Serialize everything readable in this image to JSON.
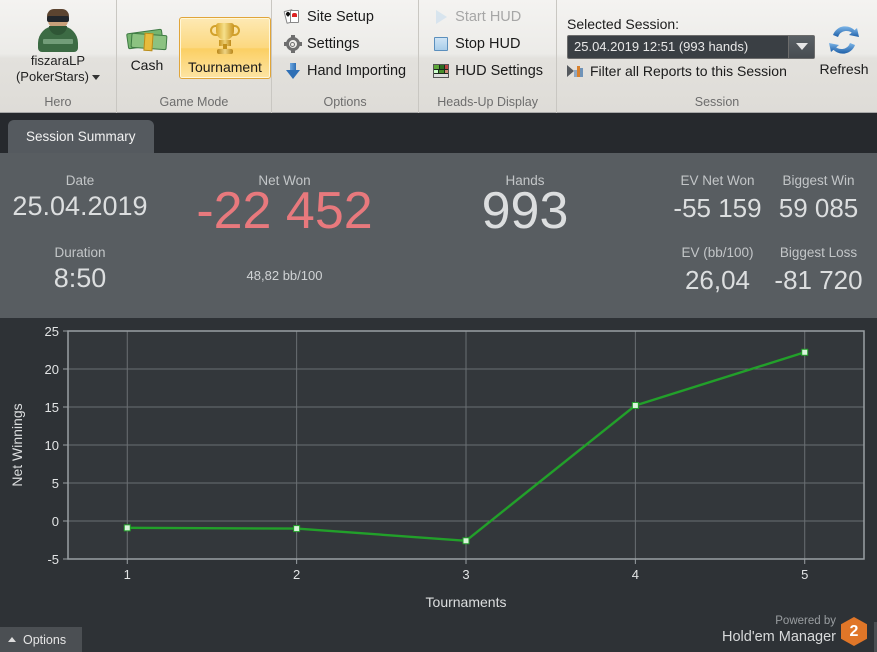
{
  "ribbon": {
    "hero": {
      "group_title": "Hero",
      "name": "fiszaraLP",
      "site": "(PokerStars)",
      "avatar_icon": "player-avatar"
    },
    "game_mode": {
      "group_title": "Game Mode",
      "cash_label": "Cash",
      "tournament_label": "Tournament",
      "selected": "Tournament"
    },
    "options": {
      "group_title": "Options",
      "items": [
        {
          "label": "Site Setup",
          "icon": "cards-icon",
          "disabled": false
        },
        {
          "label": "Settings",
          "icon": "gear-icon",
          "disabled": false
        },
        {
          "label": "Hand Importing",
          "icon": "download-arrow-icon",
          "disabled": false
        }
      ]
    },
    "hud": {
      "group_title": "Heads-Up Display",
      "items": [
        {
          "label": "Start HUD",
          "icon": "play-icon",
          "disabled": true
        },
        {
          "label": "Stop HUD",
          "icon": "stop-square-icon",
          "disabled": false
        },
        {
          "label": "HUD Settings",
          "icon": "hud-grid-icon",
          "disabled": false
        }
      ]
    },
    "session": {
      "group_title": "Session",
      "label": "Selected Session:",
      "selected_value": "25.04.2019 12:51 (993 hands)",
      "filter_label": "Filter all Reports to this Session",
      "filter_icon": "filter-chart-icon",
      "refresh_label": "Refresh",
      "refresh_icon": "refresh-icon"
    }
  },
  "tabs": [
    {
      "label": "Session Summary",
      "active": true
    }
  ],
  "stats": [
    {
      "label": "Date",
      "value": "25.04.2019",
      "key": "date"
    },
    {
      "label": "Duration",
      "value": "8:50",
      "key": "duration"
    },
    {
      "label": "Net Won",
      "value": "-22 452",
      "key": "net_won",
      "sub": "48,82 bb/100"
    },
    {
      "label": "Hands",
      "value": "993",
      "key": "hands"
    },
    {
      "label": "EV Net Won",
      "value": "-55 159",
      "key": "ev_net_won"
    },
    {
      "label": "EV (bb/100)",
      "value": "26,04",
      "key": "ev_bb100"
    },
    {
      "label": "Biggest Win",
      "value": "59 085",
      "key": "biggest_win"
    },
    {
      "label": "Biggest Loss",
      "value": "-81 720",
      "key": "biggest_loss"
    }
  ],
  "colors": {
    "negative": "#e8797d",
    "value": "#dcdedf",
    "line": "#22a02a",
    "accent_orange": "#e07628",
    "selected_tab": "#555a5f"
  },
  "chart_data": {
    "type": "line",
    "title": "",
    "xlabel": "Tournaments",
    "ylabel": "Net Winnings",
    "x": [
      1,
      2,
      3,
      4,
      5
    ],
    "categories": [
      "1",
      "2",
      "3",
      "4",
      "5"
    ],
    "series": [
      {
        "name": "Net Winnings",
        "values": [
          -0.9,
          -1.0,
          -2.6,
          15.2,
          22.2
        ],
        "color": "#22a02a"
      }
    ],
    "xlim": [
      0.65,
      5.35
    ],
    "ylim": [
      -5,
      25
    ],
    "yticks": [
      -5,
      0,
      5,
      10,
      15,
      20,
      25
    ],
    "ytick_labels": [
      "-5",
      "0",
      "5",
      "10",
      "15",
      "20",
      "25"
    ],
    "xticks": [
      1,
      2,
      3,
      4,
      5
    ],
    "xtick_labels": [
      "1",
      "2",
      "3",
      "4",
      "5"
    ],
    "grid": true,
    "legend": false,
    "markers": true
  },
  "footer": {
    "options_label": "Options",
    "powered_line1": "Powered by",
    "powered_line2": "Hold'em Manager",
    "badge": "2"
  }
}
